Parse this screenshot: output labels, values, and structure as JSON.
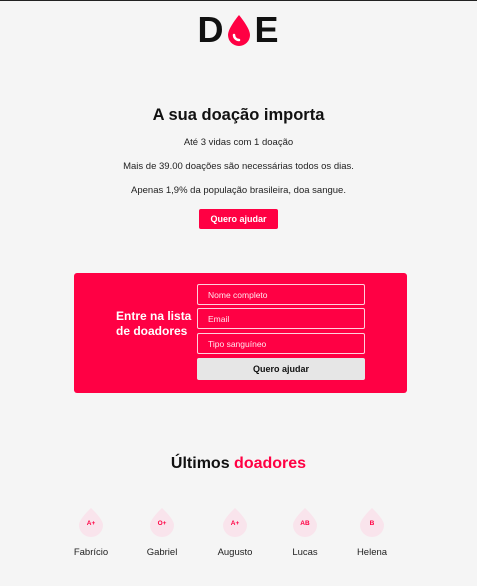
{
  "logo": {
    "left": "D",
    "right": "E",
    "brand_color": "#ff0043"
  },
  "hero": {
    "title": "A sua doação importa",
    "lines": [
      "Até 3 vidas com 1 doação",
      "Mais de 39.00 doações são necessárias todos os dias.",
      "Apenas 1,9% da população brasileira, doa sangue."
    ],
    "cta_label": "Quero ajudar"
  },
  "signup": {
    "title": "Entre na lista de doadores",
    "name_placeholder": "Nome completo",
    "email_placeholder": "Email",
    "blood_placeholder": "Tipo sanguíneo",
    "submit_label": "Quero ajudar",
    "background": "#ff0044"
  },
  "donors": {
    "title_plain": "Últimos",
    "title_accent": "doadores",
    "items": [
      {
        "blood": "A+",
        "name": "Fabrício"
      },
      {
        "blood": "O+",
        "name": "Gabriel"
      },
      {
        "blood": "A+",
        "name": "Augusto"
      },
      {
        "blood": "AB",
        "name": "Lucas"
      },
      {
        "blood": "B",
        "name": "Helena"
      }
    ]
  }
}
